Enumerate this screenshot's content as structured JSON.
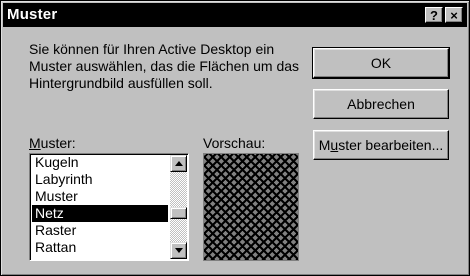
{
  "window": {
    "title": "Muster",
    "help_label": "?",
    "close_label": "×"
  },
  "description": "Sie können für Ihren Active Desktop ein Muster auswählen, das die Flächen um das Hintergrundbild ausfüllen soll.",
  "buttons": {
    "ok": "OK",
    "cancel": "Abbrechen",
    "edit_prefix": "M",
    "edit_accel": "u",
    "edit_suffix": "ster bearbeiten..."
  },
  "list": {
    "label_accel": "M",
    "label_rest": "uster:",
    "items": [
      "Kugeln",
      "Labyrinth",
      "Muster",
      "Netz",
      "Raster",
      "Rattan"
    ],
    "selected": "Netz"
  },
  "preview": {
    "label": "Vorschau:",
    "pattern_name": "Netz"
  },
  "icons": {
    "scroll_up": "arrow-up-icon",
    "scroll_down": "arrow-down-icon"
  }
}
